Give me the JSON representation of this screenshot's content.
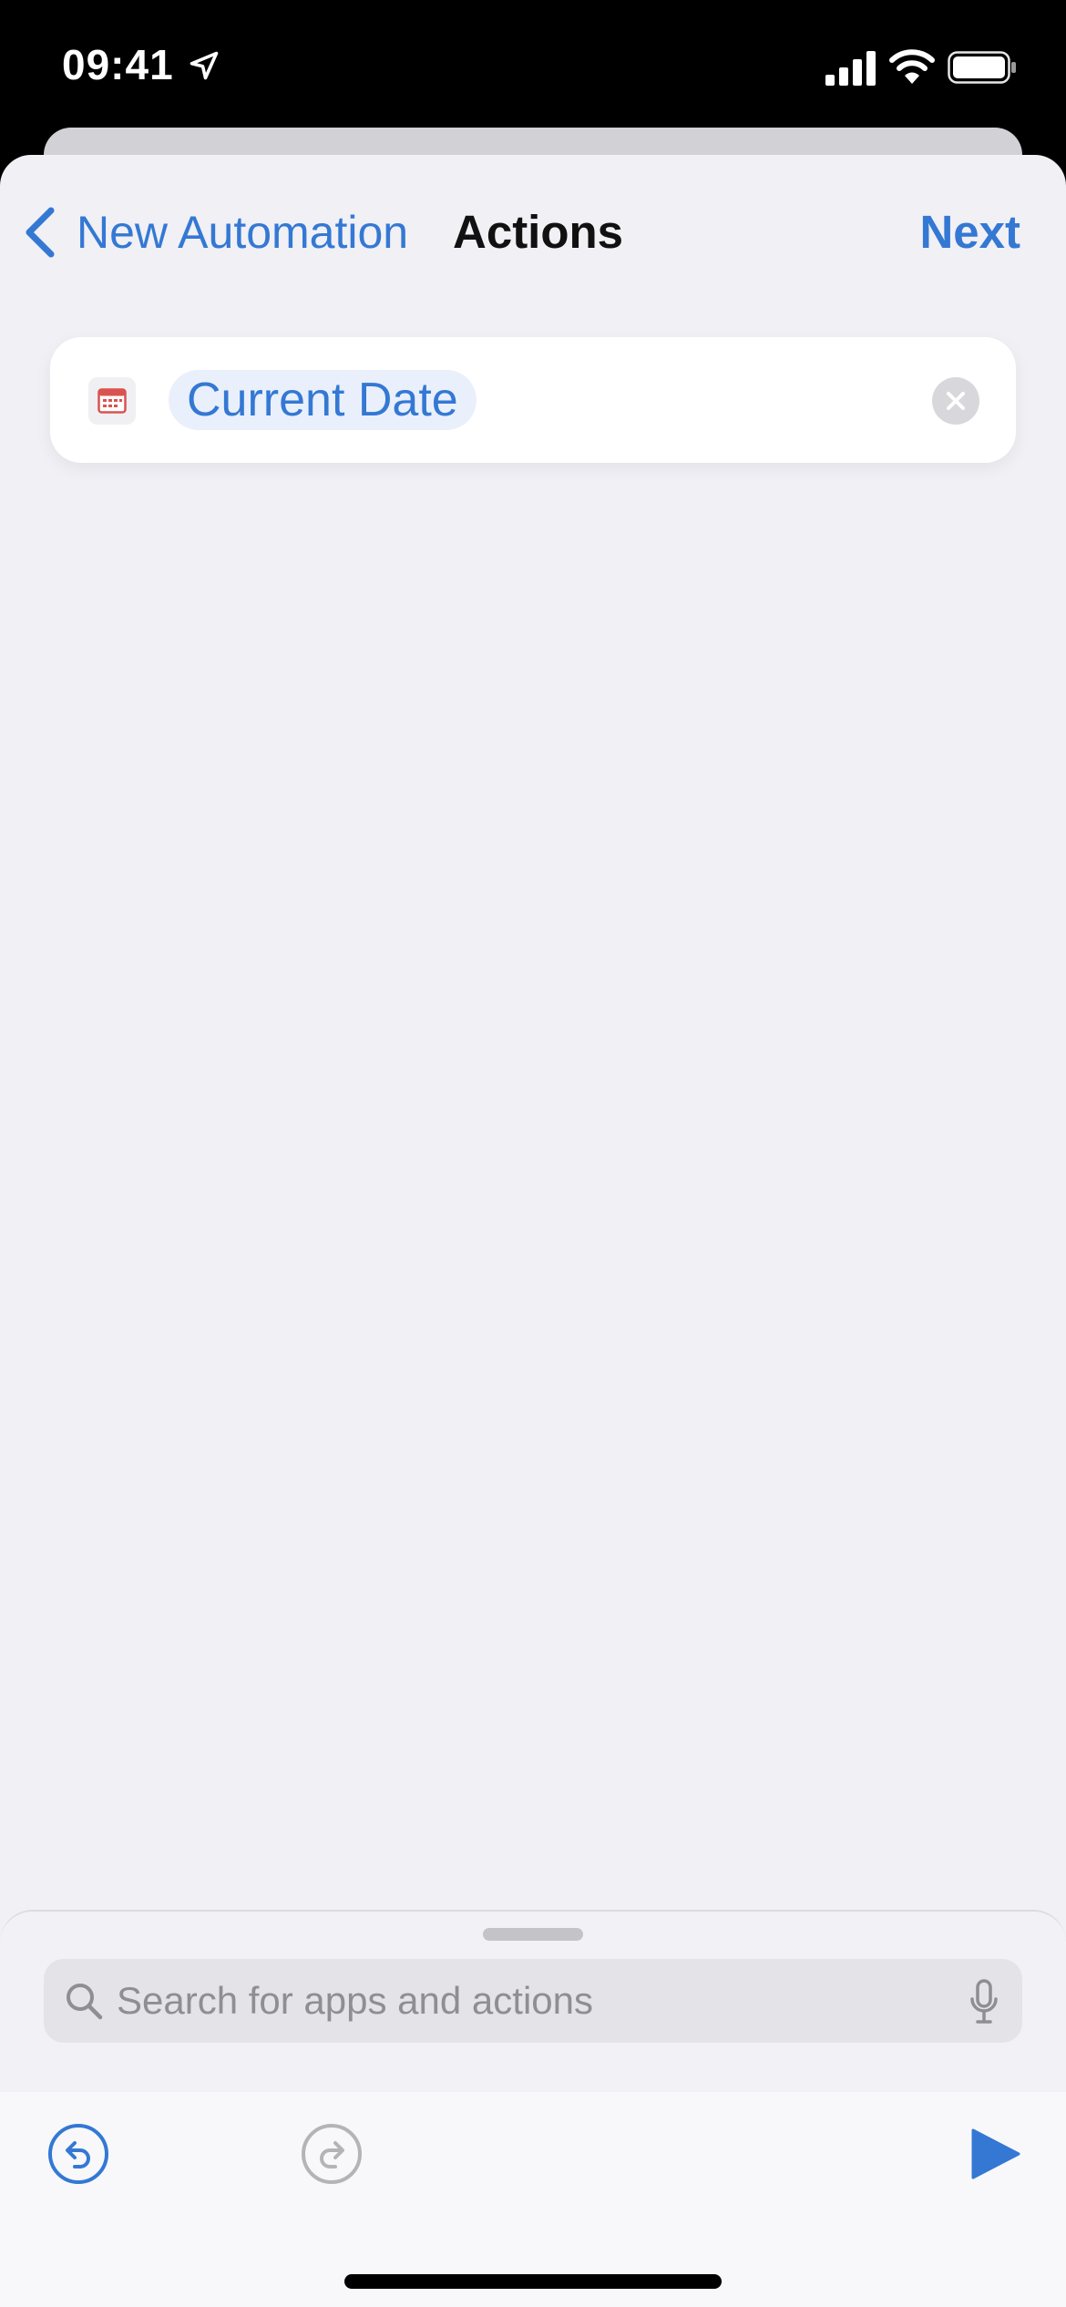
{
  "status_bar": {
    "time": "09:41",
    "icons": [
      "location-arrow-icon",
      "cellular-signal-icon",
      "wifi-icon",
      "battery-icon"
    ]
  },
  "nav": {
    "back_label": "New Automation",
    "title": "Actions",
    "next_label": "Next"
  },
  "actions": [
    {
      "icon": "calendar-icon",
      "token_label": "Current Date",
      "remove_icon": "clear-icon"
    }
  ],
  "drawer": {
    "search_placeholder": "Search for apps and actions",
    "search_value": "",
    "icons": [
      "search-icon",
      "microphone-icon"
    ]
  },
  "toolbar": {
    "icons": [
      "undo-icon",
      "redo-icon",
      "play-icon"
    ],
    "undo_enabled": true,
    "redo_enabled": false
  },
  "colors": {
    "accent": "#3478d4",
    "background": "#f0f0f5",
    "calendar_red": "#d9534f"
  }
}
